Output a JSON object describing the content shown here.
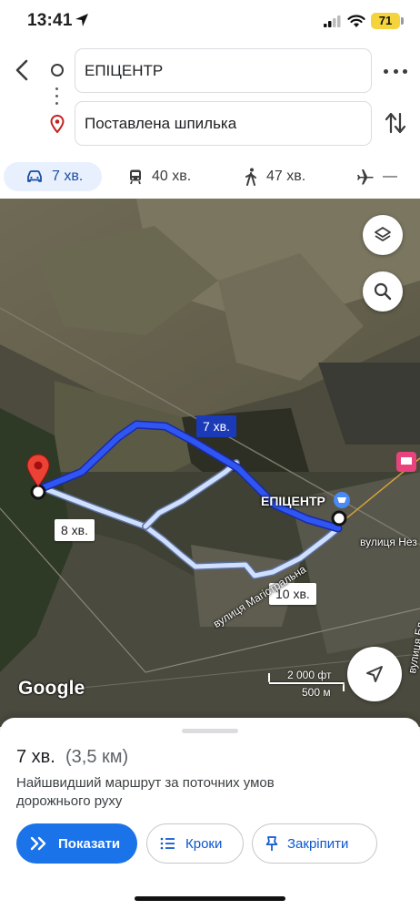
{
  "status_bar": {
    "time": "13:41",
    "battery": "71",
    "battery_color": "#f5d33d"
  },
  "directions": {
    "origin": "ЕПІЦЕНТР",
    "destination": "Поставлена шпилька"
  },
  "modes": [
    {
      "icon": "car-icon",
      "label": "7 хв.",
      "active": true
    },
    {
      "icon": "transit-icon",
      "label": "40 хв.",
      "active": false
    },
    {
      "icon": "walk-icon",
      "label": "47 хв.",
      "active": false
    },
    {
      "icon": "flight-icon",
      "label": "—",
      "active": false
    }
  ],
  "map": {
    "route_labels": {
      "primary": "7 хв.",
      "alt_1": "8 хв.",
      "alt_2": "10 хв."
    },
    "poi": "ЕПІЦЕНТР",
    "streets": {
      "street_1": "вулиця Магістральна",
      "street_2": "вулиця Нез",
      "street_3": "вулиця Бл"
    },
    "logo": "Google",
    "scale_ft": "2 000 фт",
    "scale_m": "500 м",
    "colors": {
      "primary_route": "#2f56f2",
      "alt_route": "#cfe0ff",
      "pin": "#ea4335"
    }
  },
  "sheet": {
    "time": "7 хв.",
    "distance": "(3,5 км)",
    "description": "Найшвидший маршрут за поточних умов дорожнього руху",
    "buttons": {
      "start": "Показати",
      "steps": "Кроки",
      "pin": "Закріпити"
    },
    "accent": "#1a73e8"
  }
}
